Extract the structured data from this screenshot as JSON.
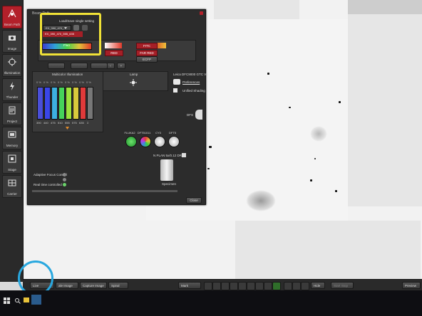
{
  "dialog": {
    "title": "Beam Path",
    "popup_title": "Load/Save single setting",
    "popup_selected": "EX_390_470_...",
    "popup_placeholder": "Quick setting...",
    "popup_item": "EX_390_470_555_635"
  },
  "left_bar": {
    "items": [
      {
        "label": "Beam Path",
        "icon": "beam-path-icon"
      },
      {
        "label": "Image",
        "icon": "camera-icon"
      },
      {
        "label": "Illumination",
        "icon": "illumination-icon"
      },
      {
        "label": "Thunder",
        "icon": "thunder-icon"
      },
      {
        "label": "Project",
        "icon": "project-icon"
      },
      {
        "label": "Memory",
        "icon": "memory-icon"
      },
      {
        "label": "Stage",
        "icon": "stage-icon"
      },
      {
        "label": "Carrier",
        "icon": "carrier-icon"
      }
    ]
  },
  "filters": {
    "fluo_label": "Fluo",
    "red": "RED",
    "far_red": "FAR RED",
    "fitc": "FITC",
    "ecfp": "ECFP"
  },
  "illumination": {
    "title": "Multicolor Illumination",
    "channels": [
      {
        "top": "0 %",
        "bottom": "390",
        "color": "#4a4fd8"
      },
      {
        "top": "0 %",
        "bottom": "440",
        "color": "#3a46e8"
      },
      {
        "top": "0 %",
        "bottom": "475",
        "color": "#3db0e0"
      },
      {
        "top": "0 %",
        "bottom": "510",
        "color": "#46d35a"
      },
      {
        "top": "0 %",
        "bottom": "555",
        "color": "#9ee23d"
      },
      {
        "top": "0 %",
        "bottom": "575",
        "color": "#d8c93c"
      },
      {
        "top": "0 %",
        "bottom": "635",
        "color": "#e03a3a"
      },
      {
        "top": "0 %",
        "bottom": "Σ",
        "color": "#666666"
      }
    ],
    "fill_levels": [
      0,
      0,
      0,
      0,
      0,
      0,
      0,
      0
    ]
  },
  "lamp": {
    "title": "Lamp"
  },
  "camera": {
    "name": "Leica DFC9000 GTC VS",
    "preferences": "Preferences",
    "unified_shading": "Unified Shading",
    "dfs": "DFS"
  },
  "cubes": {
    "items": [
      {
        "label": "FLUKA2",
        "color": "#2fbf3a"
      },
      {
        "label": "DFT51011",
        "color": "#c04ad0"
      },
      {
        "label": "CY3",
        "color": "#d8d8d8"
      },
      {
        "label": "DFT5",
        "color": "#cfcfcf"
      }
    ]
  },
  "objective": {
    "name": "N PLAN 5x/0.12 DRY",
    "specimen": "Specimen"
  },
  "status": {
    "adaptive_focus": "Adaptive Focus Control",
    "realtime": "Real time controlled"
  },
  "dialog_buttons": {
    "close": "Close"
  },
  "toolbar": {
    "live": "Live",
    "capture_label": "ale Image",
    "capture_image": "Capture Image",
    "spiral": "Spiral",
    "mark": "Mark",
    "hide": "Hide",
    "start_stop": "Start Stop",
    "preview": "Preview"
  },
  "highlight": {
    "yellow_color": "#f1e237",
    "blue_color": "#29a8df"
  },
  "accent": "#a51f27"
}
